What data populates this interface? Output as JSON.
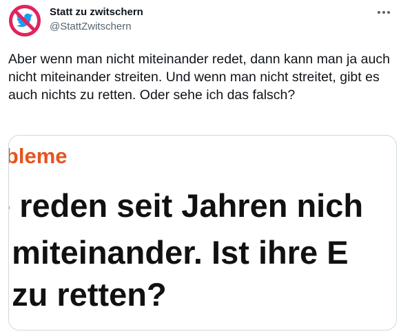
{
  "tweet": {
    "display_name": "Statt zu zwitschern",
    "handle": "@StattZwitschern",
    "avatar_icon": "crossed-out-twitter-bird-icon",
    "more_icon": "more-options-icon",
    "text": "Aber wenn man nicht miteinander redet, dann kann man ja auch nicht miteinander streiten. Und wenn man nicht streitet, gibt es auch nichts zu retten. Oder sehe ich das falsch?"
  },
  "media": {
    "kicker": "obleme",
    "headline_lines": [
      "e reden seit Jahren nich",
      "ı miteinander. Ist ihre E",
      "ı zu retten?"
    ]
  },
  "colors": {
    "avatar_ring": "#e0245e",
    "bird": "#1d9bf0",
    "kicker": "#e8531c",
    "text": "#0f1419",
    "secondary_text": "#536471",
    "border": "#cfd9de"
  }
}
